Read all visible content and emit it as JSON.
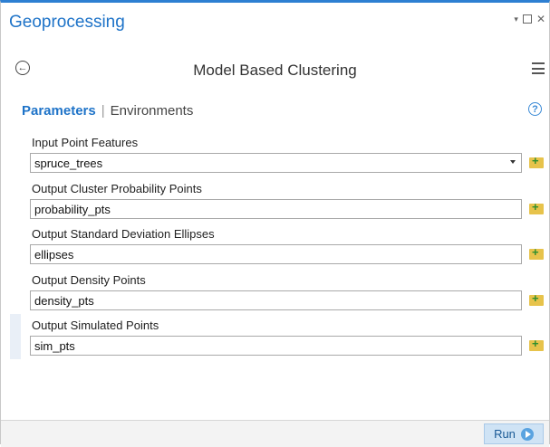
{
  "panel": {
    "title": "Geoprocessing",
    "controls": {
      "pin": "▾",
      "close": "✕"
    }
  },
  "tool": {
    "title": "Model Based Clustering",
    "back_icon": "back-arrow-circle-icon",
    "menu_icon": "hamburger-menu-icon"
  },
  "tabs": {
    "parameters": "Parameters",
    "separator": "|",
    "environments": "Environments",
    "help": "?"
  },
  "parameters": [
    {
      "label": "Input Point Features",
      "value": "spruce_trees",
      "type": "dropdown"
    },
    {
      "label": "Output Cluster Probability Points",
      "value": "probability_pts",
      "type": "text"
    },
    {
      "label": "Output Standard Deviation Ellipses",
      "value": "ellipses",
      "type": "text"
    },
    {
      "label": "Output Density Points",
      "value": "density_pts",
      "type": "text"
    },
    {
      "label": "Output Simulated Points",
      "value": "sim_pts",
      "type": "text"
    }
  ],
  "footer": {
    "run_label": "Run"
  },
  "colors": {
    "accent": "#1e73c8",
    "browse_folder": "#e7c34b",
    "browse_plus": "#2f8f2f"
  }
}
